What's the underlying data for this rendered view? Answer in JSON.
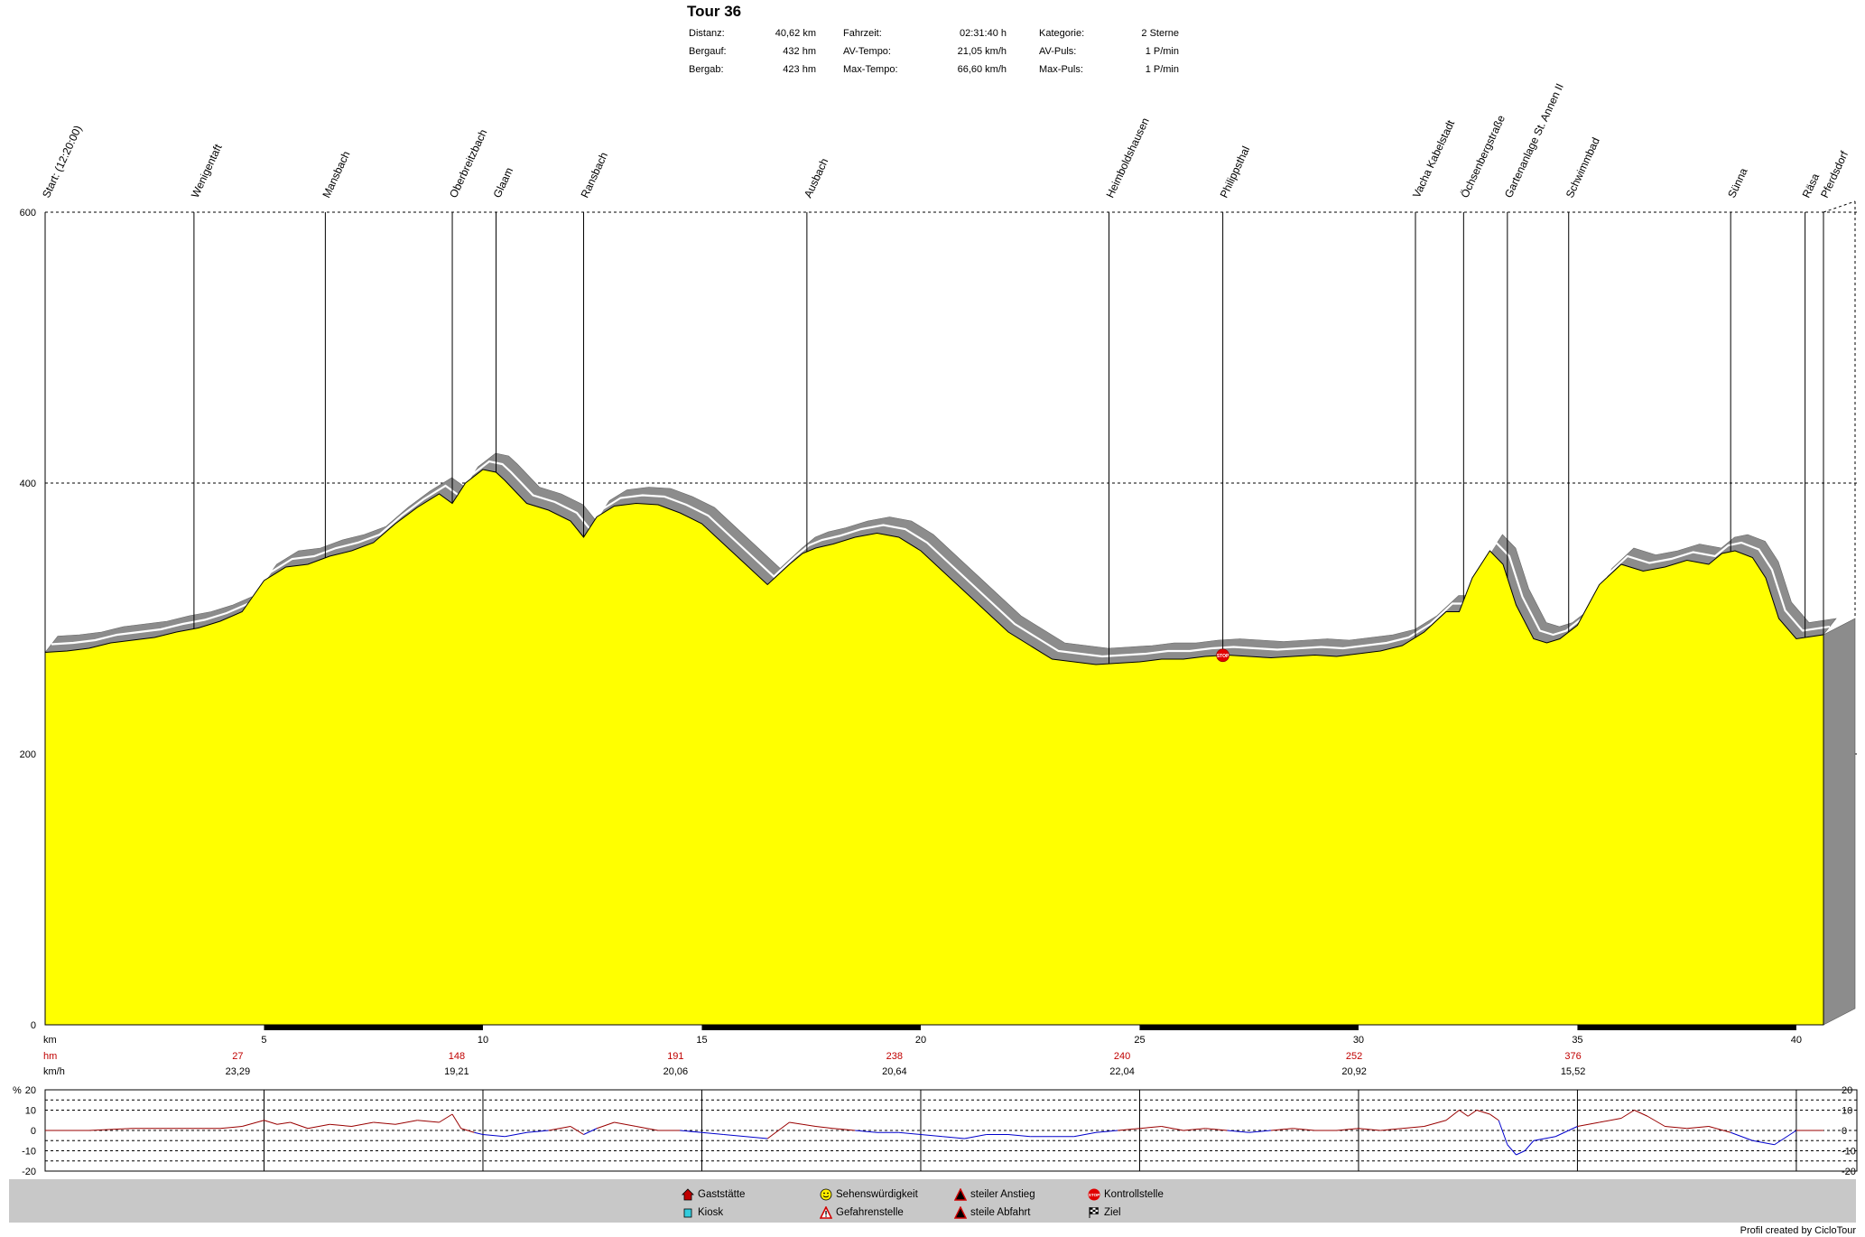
{
  "header": {
    "title": "Tour 36",
    "stats": [
      {
        "label": "Distanz:",
        "value": "40,62 km"
      },
      {
        "label": "Bergauf:",
        "value": "432 hm"
      },
      {
        "label": "Bergab:",
        "value": "423 hm"
      },
      {
        "label": "Fahrzeit:",
        "value": "02:31:40 h"
      },
      {
        "label": "AV-Tempo:",
        "value": "21,05 km/h"
      },
      {
        "label": "Max-Tempo:",
        "value": "66,60 km/h"
      },
      {
        "label": "Kategorie:",
        "value": "2 Sterne"
      },
      {
        "label": "AV-Puls:",
        "value": "1 P/min"
      },
      {
        "label": "Max-Puls:",
        "value": "1 P/min"
      }
    ]
  },
  "chart_data": [
    {
      "type": "area",
      "y_ticks": [
        "0",
        "200",
        "400",
        "600"
      ],
      "x_ticks": [
        "5",
        "10",
        "15",
        "20",
        "25",
        "30",
        "35",
        "40"
      ],
      "xlim": [
        0,
        40.62
      ],
      "ylim": [
        0,
        600
      ],
      "grid": true,
      "fill_color": "#ffff00",
      "profile": {
        "x": [
          0,
          0.5,
          1,
          1.5,
          2,
          2.5,
          3,
          3.5,
          4,
          4.5,
          5,
          5.5,
          6,
          6.5,
          7,
          7.5,
          8,
          8.5,
          9,
          9.3,
          9.6,
          10,
          10.3,
          10.5,
          11,
          11.5,
          12,
          12.3,
          12.6,
          13,
          13.5,
          14,
          14.5,
          15,
          15.5,
          16,
          16.5,
          17,
          17.3,
          17.6,
          18,
          18.5,
          19,
          19.5,
          20,
          20.5,
          21,
          21.5,
          22,
          22.5,
          23,
          23.5,
          24,
          24.5,
          25,
          25.5,
          26,
          26.5,
          27,
          27.5,
          28,
          28.5,
          29,
          29.5,
          30,
          30.5,
          31,
          31.5,
          32,
          32.3,
          32.6,
          33,
          33.3,
          33.6,
          34,
          34.3,
          34.6,
          35,
          35.5,
          36,
          36.5,
          37,
          37.5,
          38,
          38.3,
          38.6,
          39,
          39.3,
          39.6,
          40,
          40.62
        ],
        "y": [
          275,
          276,
          278,
          282,
          284,
          286,
          290,
          293,
          298,
          305,
          328,
          338,
          340,
          346,
          350,
          356,
          370,
          382,
          392,
          385,
          400,
          410,
          408,
          402,
          385,
          380,
          372,
          360,
          375,
          383,
          385,
          384,
          378,
          370,
          355,
          340,
          325,
          340,
          348,
          352,
          355,
          360,
          363,
          360,
          350,
          335,
          320,
          305,
          290,
          280,
          270,
          268,
          266,
          267,
          268,
          270,
          270,
          272,
          273,
          272,
          271,
          272,
          273,
          272,
          274,
          276,
          280,
          290,
          305,
          305,
          330,
          350,
          340,
          310,
          285,
          282,
          285,
          295,
          325,
          340,
          335,
          338,
          343,
          340,
          348,
          350,
          345,
          330,
          300,
          285,
          288
        ]
      },
      "start_label": "Start: (12:20:00)",
      "waypoints": [
        {
          "km": 3.4,
          "name": "Wenigentaft"
        },
        {
          "km": 6.4,
          "name": "Mansbach"
        },
        {
          "km": 9.3,
          "name": "Oberbreitzbach"
        },
        {
          "km": 10.3,
          "name": "Glaam"
        },
        {
          "km": 12.3,
          "name": "Ransbach"
        },
        {
          "km": 17.4,
          "name": "Ausbach"
        },
        {
          "km": 24.3,
          "name": "Heimboldshausen"
        },
        {
          "km": 26.9,
          "name": "Philippsthal"
        },
        {
          "km": 31.3,
          "name": "Vacha Kabelstadt"
        },
        {
          "km": 32.4,
          "name": "Öchsenbergstraße"
        },
        {
          "km": 33.4,
          "name": "Gartenanlage St. Annen II"
        },
        {
          "km": 34.8,
          "name": "Schwimmbad"
        },
        {
          "km": 38.5,
          "name": "Sünna"
        },
        {
          "km": 40.2,
          "name": "Räsa"
        },
        {
          "km": 40.62,
          "name": "Pferdsdorf"
        }
      ],
      "stop_marker_km": 26.9
    },
    {
      "type": "table",
      "rows": [
        {
          "label": "km",
          "values": []
        },
        {
          "label": "hm",
          "values": [
            {
              "km": 4.4,
              "v": "27"
            },
            {
              "km": 9.4,
              "v": "148"
            },
            {
              "km": 14.4,
              "v": "191"
            },
            {
              "km": 19.4,
              "v": "238"
            },
            {
              "km": 24.6,
              "v": "240"
            },
            {
              "km": 29.9,
              "v": "252"
            },
            {
              "km": 34.9,
              "v": "376"
            }
          ]
        },
        {
          "label": "km/h",
          "values": [
            {
              "km": 4.4,
              "v": "23,29"
            },
            {
              "km": 9.4,
              "v": "19,21"
            },
            {
              "km": 14.4,
              "v": "20,06"
            },
            {
              "km": 19.4,
              "v": "20,64"
            },
            {
              "km": 24.6,
              "v": "22,04"
            },
            {
              "km": 29.9,
              "v": "20,92"
            },
            {
              "km": 34.9,
              "v": "15,52"
            }
          ]
        }
      ]
    },
    {
      "type": "line",
      "ylabel": "%",
      "y_ticks": [
        "20",
        "10",
        "0",
        "-10",
        "-20"
      ],
      "ylim": [
        -20,
        20
      ],
      "gradient": {
        "x": [
          0,
          1,
          2,
          3,
          4,
          4.5,
          5,
          5.3,
          5.6,
          6,
          6.5,
          7,
          7.5,
          8,
          8.5,
          9,
          9.3,
          9.5,
          9.8,
          10,
          10.5,
          11,
          11.5,
          12,
          12.3,
          12.6,
          13,
          13.5,
          14,
          14.5,
          15,
          15.5,
          16,
          16.5,
          17,
          17.3,
          17.6,
          18,
          18.5,
          19,
          19.5,
          20,
          20.5,
          21,
          21.5,
          22,
          22.5,
          23,
          23.5,
          24,
          24.5,
          25,
          25.5,
          26,
          26.5,
          27,
          27.5,
          28,
          28.5,
          29,
          29.5,
          30,
          30.5,
          31,
          31.5,
          32,
          32.3,
          32.5,
          32.7,
          33,
          33.2,
          33.4,
          33.6,
          33.8,
          34,
          34.5,
          35,
          35.5,
          36,
          36.3,
          36.6,
          37,
          37.5,
          38,
          38.5,
          39,
          39.5,
          40,
          40.62
        ],
        "y": [
          0,
          0,
          1,
          1,
          1,
          2,
          5,
          3,
          4,
          1,
          3,
          2,
          4,
          3,
          5,
          4,
          8,
          1,
          -1,
          -2,
          -3,
          -1,
          0,
          2,
          -2,
          1,
          4,
          2,
          0,
          0,
          -1,
          -2,
          -3,
          -4,
          4,
          3,
          2,
          1,
          0,
          -1,
          -1,
          -2,
          -3,
          -4,
          -2,
          -2,
          -3,
          -3,
          -3,
          -1,
          0,
          1,
          2,
          0,
          1,
          0,
          -1,
          0,
          1,
          0,
          0,
          1,
          0,
          1,
          2,
          5,
          10,
          7,
          10,
          8,
          5,
          -7,
          -12,
          -10,
          -5,
          -3,
          2,
          4,
          6,
          10,
          7,
          2,
          1,
          2,
          -1,
          -5,
          -7,
          0,
          0
        ]
      }
    }
  ],
  "legend": [
    {
      "icon": "house-icon",
      "label": "Gaststätte"
    },
    {
      "icon": "kiosk-icon",
      "label": "Kiosk"
    },
    {
      "icon": "smiley-icon",
      "label": "Sehenswürdigkeit"
    },
    {
      "icon": "warning-icon",
      "label": "Gefahrenstelle"
    },
    {
      "icon": "climb-icon",
      "label": "steiler Anstieg"
    },
    {
      "icon": "descent-icon",
      "label": "steile Abfahrt"
    },
    {
      "icon": "stop-icon",
      "label": "Kontrollstelle"
    },
    {
      "icon": "flag-icon",
      "label": "Ziel"
    }
  ],
  "stop_text": "STOP",
  "credit": "Profil created by CicloTour"
}
